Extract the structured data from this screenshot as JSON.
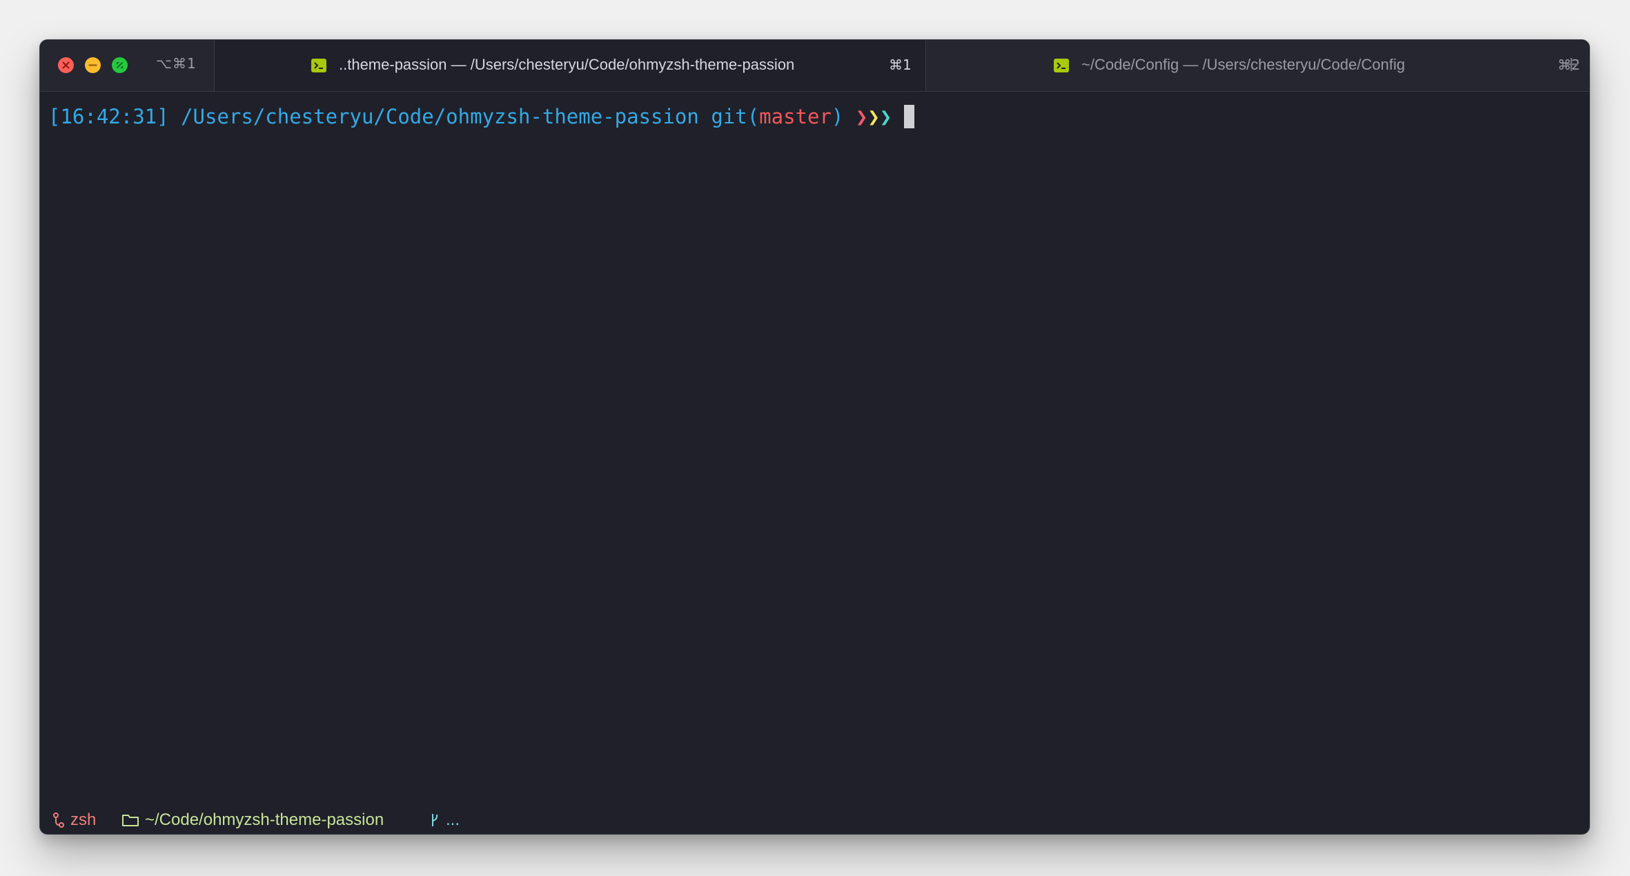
{
  "window": {
    "left_hotkey": "⌥⌘1",
    "new_tab_label": "+"
  },
  "tabs": [
    {
      "title": "..theme-passion — /Users/chesteryu/Code/ohmyzsh-theme-passion",
      "hotkey": "⌘1",
      "icon": "terminal-icon",
      "active": true
    },
    {
      "title": "~/Code/Config — /Users/chesteryu/Code/Config",
      "hotkey": "⌘2",
      "icon": "terminal-icon",
      "active": false
    }
  ],
  "prompt": {
    "time": "[16:42:31]",
    "path": "/Users/chesteryu/Code/ohmyzsh-theme-passion",
    "git_prefix": "git(",
    "branch": "master",
    "git_suffix": ")",
    "arrow1": "❯",
    "arrow2": "❯",
    "arrow3": "❯"
  },
  "statusbar": {
    "shell": "zsh",
    "directory": "~/Code/ohmyzsh-theme-passion",
    "git": "..."
  },
  "colors": {
    "terminal_bg": "#1f2029",
    "prompt_blue": "#35a9e6",
    "branch_red": "#f2585a",
    "arrow_red": "#f35c6a",
    "arrow_yellow": "#f4e75a",
    "arrow_teal": "#4bd9c9",
    "tab_icon_green": "#a8c90c"
  }
}
